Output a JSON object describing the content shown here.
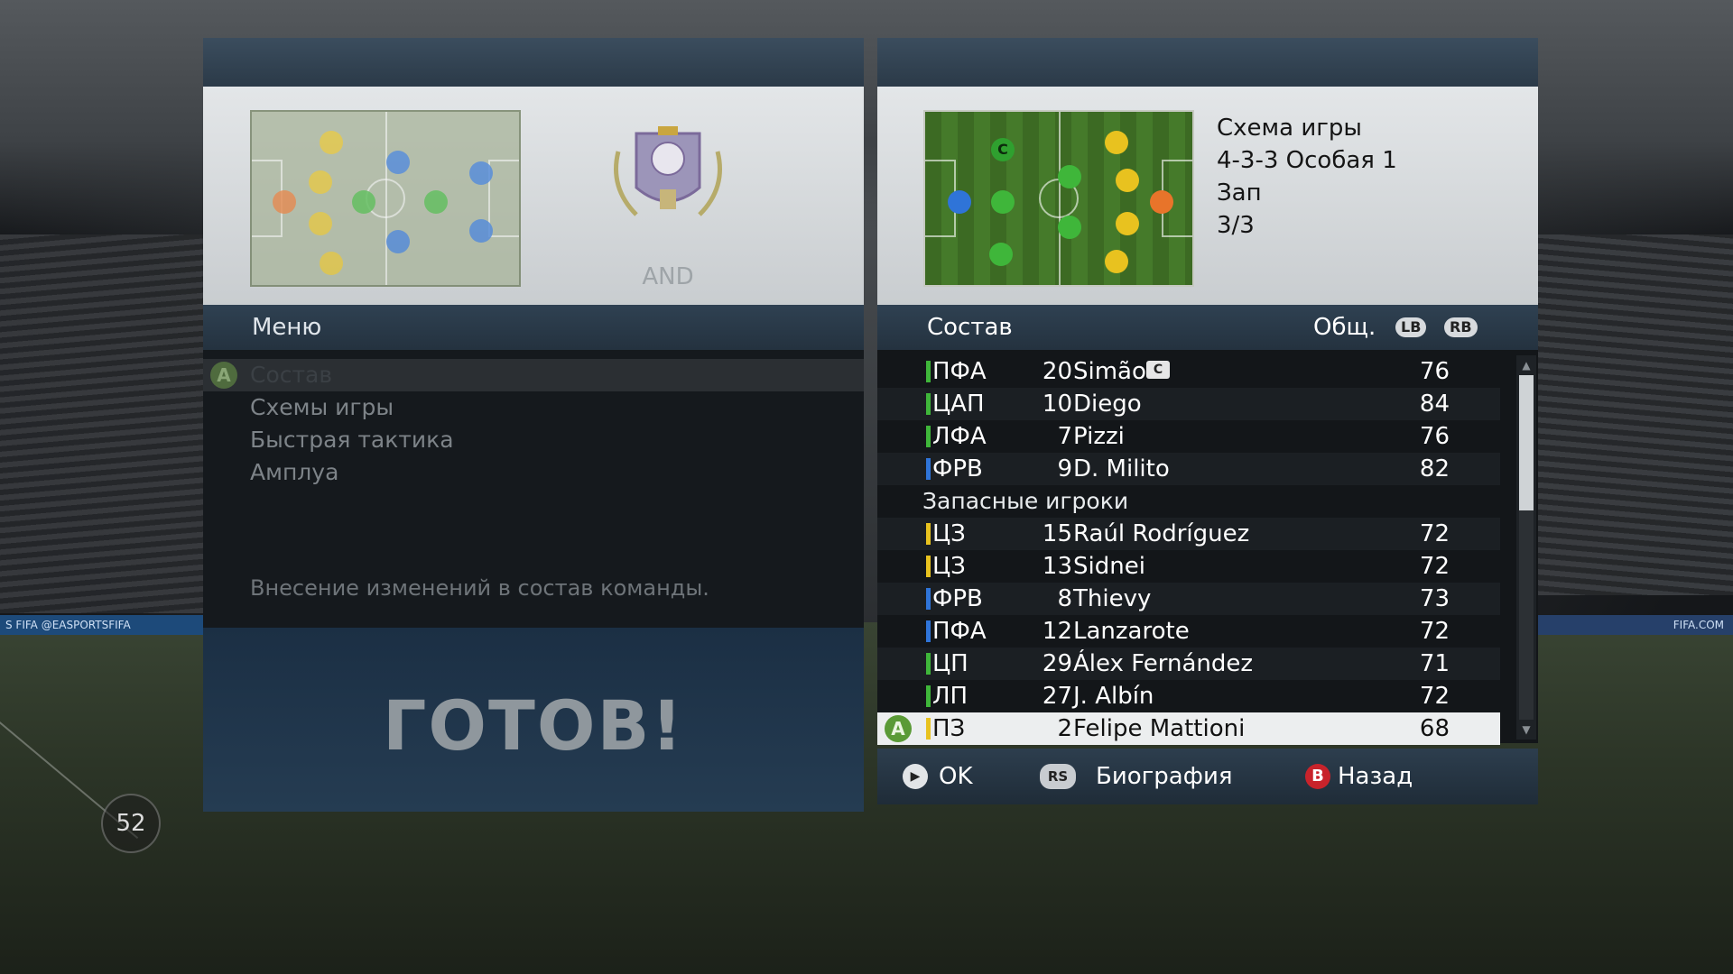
{
  "background": {
    "jersey_number": "52",
    "ad_left": "S FIFA   @EASPORTSFIFA",
    "ad_right": "FIFA.COM"
  },
  "left_panel": {
    "crest_label": "AND",
    "menu_title": "Меню",
    "menu_items": [
      {
        "label": "Состав",
        "selected": true,
        "badge": "A"
      },
      {
        "label": "Схемы игры"
      },
      {
        "label": "Быстрая тактика"
      },
      {
        "label": "Амплуа"
      }
    ],
    "hint": "Внесение изменений в состав команды.",
    "ready": "ГОТОВ!"
  },
  "right_panel": {
    "formation": {
      "line1": "Схема игры",
      "line2": "4-3-3 Особая 1",
      "line3": "Зап",
      "line4": "3/3"
    },
    "captain_marker": "C",
    "list_title": "Состав",
    "stat_label": "Общ.",
    "lb": "LB",
    "rb": "RB",
    "starters": [
      {
        "pos": "ПФА",
        "num": "20",
        "name": "Simão",
        "rating": "76",
        "color": "#3fb63a",
        "captain": "C"
      },
      {
        "pos": "ЦАП",
        "num": "10",
        "name": "Diego",
        "rating": "84",
        "color": "#3fb63a"
      },
      {
        "pos": "ЛФА",
        "num": "7",
        "name": "Pizzi",
        "rating": "76",
        "color": "#3fb63a"
      },
      {
        "pos": "ФРВ",
        "num": "9",
        "name": "D. Milito",
        "rating": "82",
        "color": "#2f74d8"
      }
    ],
    "subs_title": "Запасные игроки",
    "subs": [
      {
        "pos": "ЦЗ",
        "num": "15",
        "name": "Raúl Rodríguez",
        "rating": "72",
        "color": "#e8c21f"
      },
      {
        "pos": "ЦЗ",
        "num": "13",
        "name": "Sidnei",
        "rating": "72",
        "color": "#e8c21f"
      },
      {
        "pos": "ФРВ",
        "num": "8",
        "name": "Thievy",
        "rating": "73",
        "color": "#2f74d8"
      },
      {
        "pos": "ПФА",
        "num": "12",
        "name": "Lanzarote",
        "rating": "72",
        "color": "#2f74d8"
      },
      {
        "pos": "ЦП",
        "num": "29",
        "name": "Álex Fernández",
        "rating": "71",
        "color": "#3fb63a"
      },
      {
        "pos": "ЛП",
        "num": "27",
        "name": "J. Albín",
        "rating": "72",
        "color": "#3fb63a"
      },
      {
        "pos": "ПЗ",
        "num": "2",
        "name": "Felipe Mattioni",
        "rating": "68",
        "color": "#e8c21f",
        "selected": true,
        "badge": "A"
      }
    ],
    "footer": {
      "ok": "OK",
      "rs_icon": "RS",
      "bio": "Биография",
      "b_icon": "B",
      "back": "Назад"
    }
  },
  "colors": {
    "gk": "#e8742a",
    "def": "#e8c21f",
    "mid": "#3fb63a",
    "fwd": "#2f74d8"
  }
}
